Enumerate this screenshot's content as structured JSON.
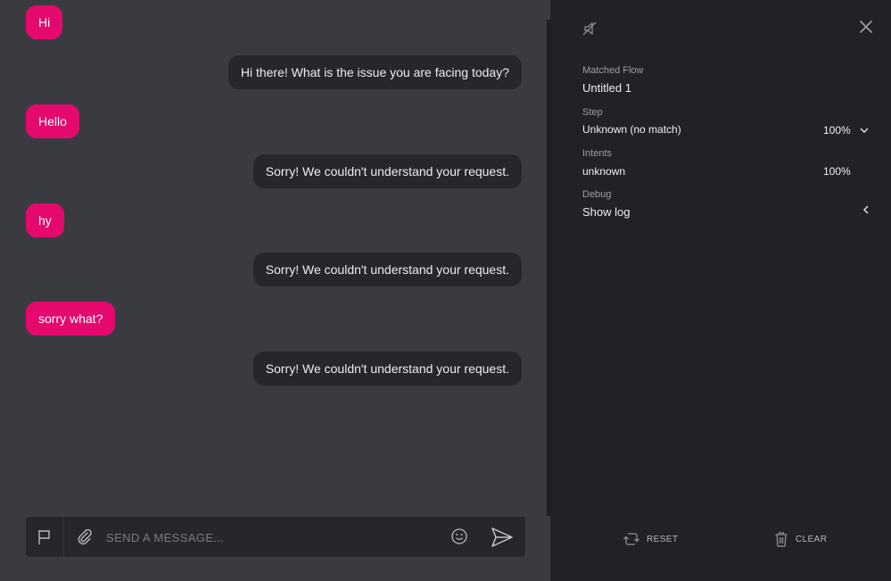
{
  "messages": [
    {
      "role": "user",
      "text": "Hi"
    },
    {
      "role": "bot",
      "text": "Hi there! What is the issue you are facing today?"
    },
    {
      "role": "user",
      "text": "Hello"
    },
    {
      "role": "bot",
      "text": "Sorry! We couldn't understand your request."
    },
    {
      "role": "user",
      "text": "hy"
    },
    {
      "role": "bot",
      "text": "Sorry! We couldn't understand your request."
    },
    {
      "role": "user",
      "text": "sorry what?"
    },
    {
      "role": "bot",
      "text": "Sorry! We couldn't understand your request."
    }
  ],
  "composer": {
    "placeholder": "SEND A MESSAGE...",
    "icons": [
      "flag-icon",
      "paperclip-icon",
      "smiley-icon",
      "send-icon"
    ]
  },
  "panel": {
    "icons": [
      "mute-icon",
      "close-icon"
    ],
    "matched_flow": {
      "label": "Matched Flow",
      "value": "Untitled 1"
    },
    "step": {
      "label": "Step",
      "value": "Unknown (no match)",
      "confidence": "100%"
    },
    "intents": {
      "label": "Intents",
      "value": "unknown",
      "confidence": "100%"
    },
    "debug": {
      "label": "Debug",
      "value": "Show log"
    },
    "reset_label": "RESET",
    "clear_label": "CLEAR"
  },
  "colors": {
    "user_bubble": "#e5096e",
    "bot_bubble": "#26272b",
    "chat_bg": "#3a3b41",
    "panel_bg": "#222226"
  }
}
